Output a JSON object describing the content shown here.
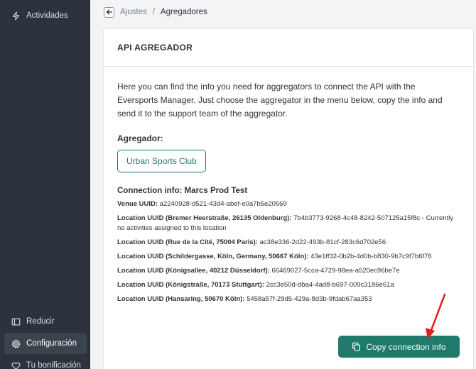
{
  "sidebar": {
    "items": [
      {
        "label": "Actividades",
        "icon": "lightning-icon"
      },
      {
        "label": "Reducir",
        "icon": "collapse-icon"
      },
      {
        "label": "Configuración",
        "icon": "gear-icon"
      },
      {
        "label": "Tu bonificación",
        "icon": "heart-icon"
      }
    ]
  },
  "breadcrumb": {
    "parent": "Ajustes",
    "separator": "/",
    "current": "Agregadores"
  },
  "card": {
    "title": "API AGREGADOR",
    "intro": "Here you can find the info you need for aggregators to connect the API with the Eversports Manager. Just choose the aggregator in the menu below, copy the info and send it to the support team of the aggregator.",
    "aggregator_label": "Agregador:",
    "aggregator_button": "Urban Sports Club",
    "connection_title": "Connection info: Marcs Prod Test",
    "rows": [
      {
        "key": "Venue UUID:",
        "value": "a2240928-d521-43d4-abef-e0a7b5e20569"
      },
      {
        "key": "Location UUID (Bremer Heerstraße, 26135 Oldenburg):",
        "value": "7b4b3773-9268-4c48-8242-507125a15f8c - Currently no activities assigned to this location"
      },
      {
        "key": "Location UUID (Rue de la Cité, 75004 Paris):",
        "value": "ac38e336-2d22-493b-81cf-283c6d702e56"
      },
      {
        "key": "Location UUID (Schildergasse, Köln, Germany, 50667 Köln):",
        "value": "43e1ff32-0b2b-4d0b-b830-9b7c9f7b6f76"
      },
      {
        "key": "Location UUID (Königsallee, 40212 Düsseldorf):",
        "value": "66469027-5cca-4729-98ea-a520ec96be7e"
      },
      {
        "key": "Location UUID (Königstraße, 70173 Stuttgart):",
        "value": "2cc3e50d-dba4-4ad8-b697-009c3186e61a"
      },
      {
        "key": "Location UUID (Hansaring, 50670 Köln):",
        "value": "5458a57f-29d5-429a-8d3b-9fdab67aa353"
      }
    ],
    "copy_button": "Copy connection info"
  },
  "colors": {
    "sidebar_bg": "#2c333c",
    "accent": "#1f7a6b",
    "annotation_arrow": "#e0201c"
  }
}
